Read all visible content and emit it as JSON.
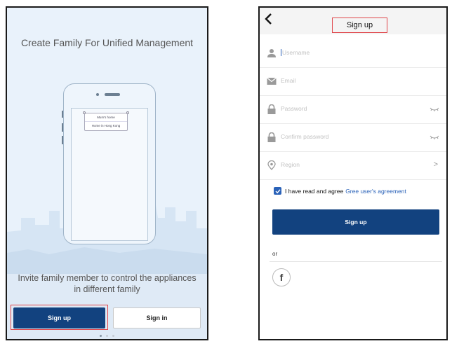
{
  "left_screen": {
    "title": "Create Family For Unified Management",
    "illustration": {
      "popup_items": [
        "Mum's home",
        "Home in Hong Kong"
      ]
    },
    "invite_text": "Invite family member to control the appliances in different family",
    "signup_button": "Sign up",
    "signin_button": "Sign in",
    "pager": {
      "pages": 3,
      "active": 1
    }
  },
  "right_screen": {
    "header": {
      "back_icon": "chevron-left-icon",
      "title": "Sign up"
    },
    "fields": [
      {
        "icon": "user-icon",
        "placeholder": "Username",
        "trailing": ""
      },
      {
        "icon": "mail-icon",
        "placeholder": "Email",
        "trailing": ""
      },
      {
        "icon": "lock-icon",
        "placeholder": "Password",
        "trailing": "eye-closed-icon"
      },
      {
        "icon": "lock-icon",
        "placeholder": "Confirm password",
        "trailing": "eye-closed-icon"
      },
      {
        "icon": "location-pin-icon",
        "placeholder": "Region",
        "trailing": "chevron-right-icon"
      }
    ],
    "region_chevron": ">",
    "agreement": {
      "checked": true,
      "text": "I have read and agree",
      "link": "Gree user's agreement"
    },
    "signup_button": "Sign up",
    "or_label": "or",
    "social": {
      "facebook_glyph": "f"
    }
  },
  "colors": {
    "primary": "#12427f",
    "link": "#2a62b8",
    "highlight_outline": "#e0454a",
    "left_background": "#e9f2fb"
  }
}
